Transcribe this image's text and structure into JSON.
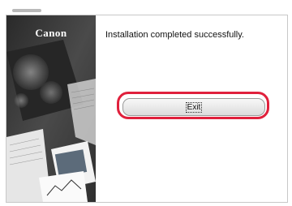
{
  "brand": {
    "logo_text": "Canon"
  },
  "dialog": {
    "message": "Installation completed successfully.",
    "exit_label": "Exit",
    "highlight_color": "#e0203c"
  }
}
